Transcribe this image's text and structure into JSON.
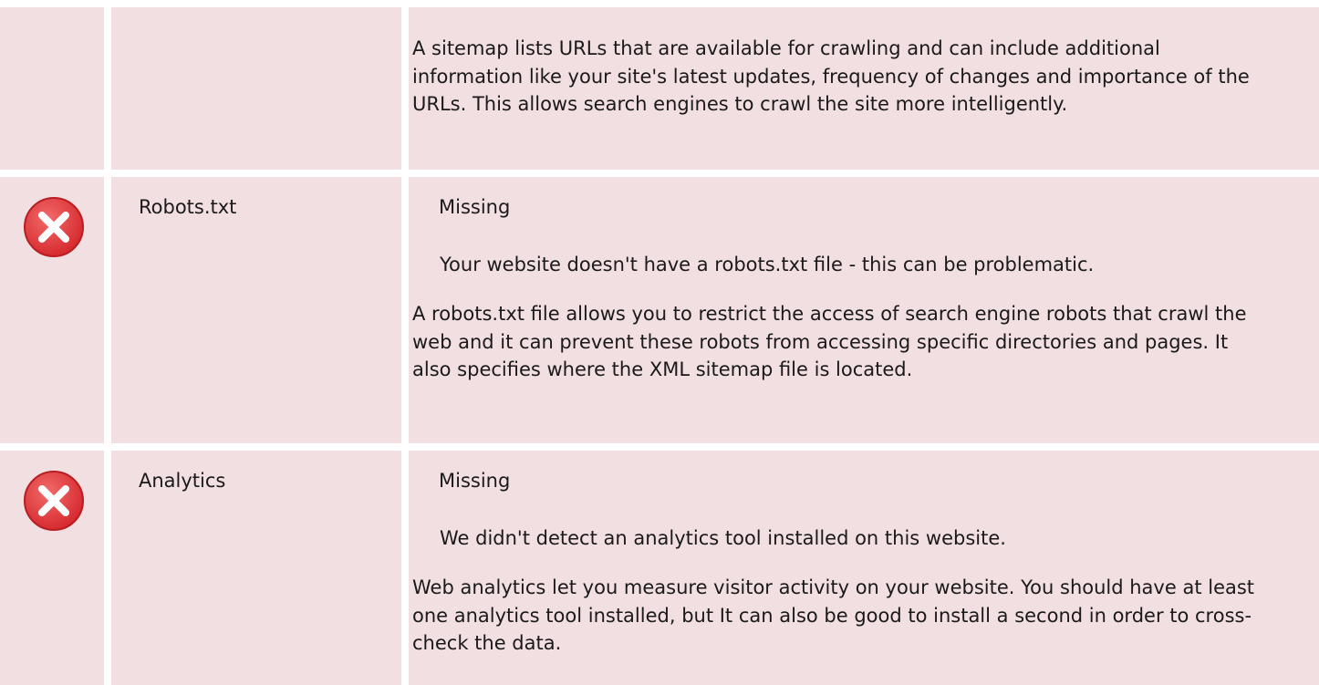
{
  "sitemap_row": {
    "description": "A sitemap lists URLs that are available for crawling and can include additional information like your site's latest updates, frequency of changes and importance of the URLs. This allows search engines to crawl the site more intelligently."
  },
  "robots_row": {
    "icon": "error-icon",
    "name": "Robots.txt",
    "status": "Missing",
    "summary": "Your website doesn't have a robots.txt file - this can be problematic.",
    "description": "A robots.txt file allows you to restrict the access of search engine robots that crawl the web and it can prevent these robots from accessing specific directories and pages. It also specifies where the XML sitemap file is located."
  },
  "analytics_row": {
    "icon": "error-icon",
    "name": "Analytics",
    "status": "Missing",
    "summary": "We didn't detect an analytics tool installed on this website.",
    "description": "Web analytics let you measure visitor activity on your website. You should have at least one analytics tool installed, but It can also be good to install a second in order to cross-check the data."
  },
  "colors": {
    "cell_background": "#f2dfe1",
    "divider": "#ffffff",
    "error_red": "#e8383b"
  }
}
